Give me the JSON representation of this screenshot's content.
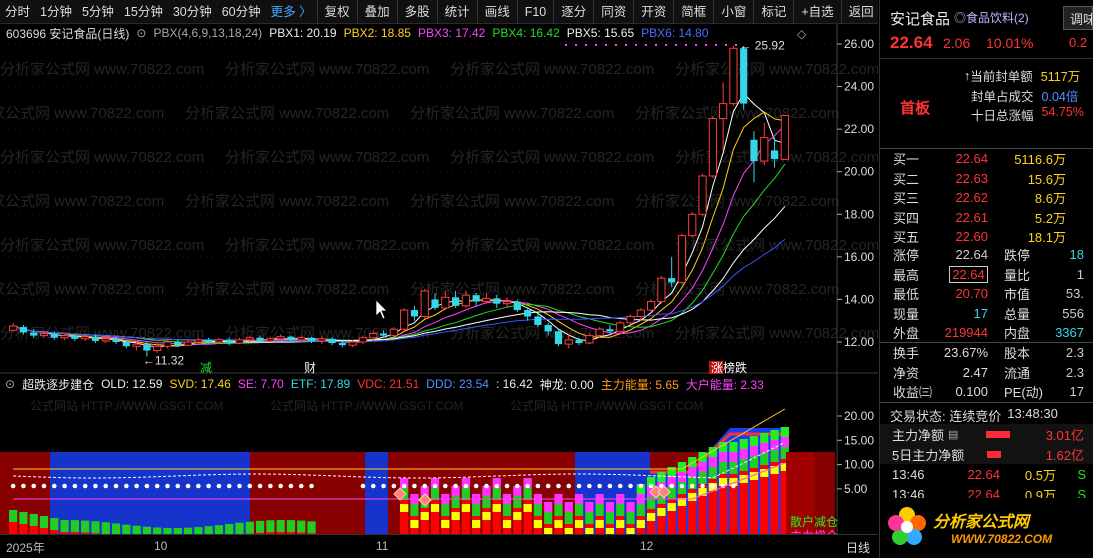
{
  "toolbar": {
    "periods": [
      "分时",
      "1分钟",
      "5分钟",
      "15分钟",
      "30分钟",
      "60分钟"
    ],
    "more": "更多 〉",
    "tools": [
      "复权",
      "叠加",
      "多股",
      "统计",
      "画线",
      "F10",
      "逐分",
      "同资",
      "开资",
      "简框",
      "小窗",
      "标记",
      "+自选",
      "返回"
    ]
  },
  "main_header": {
    "code_name": "603696 安记食品(日线)",
    "indicator": "PBX(4,6,9,13,18,24)",
    "pbx1": "PBX1: 20.19",
    "pbx2": "PBX2: 18.85",
    "pbx3": "PBX3: 17.42",
    "pbx4": "PBX4: 16.42",
    "pbx5": "PBX5: 15.65",
    "pbx6": "PBX6: 14.80"
  },
  "sub_header": {
    "name": "超跌逐步建仓",
    "old": "OLD: 12.59",
    "svd": "SVD: 17.46",
    "se": "SE: 7.70",
    "etf": "ETF: 17.89",
    "vdc": "VDC: 21.51",
    "ddd": "DDD: 23.54",
    "x": ": 16.42",
    "shenlong": "神龙: 0.00",
    "zhuli": "主力能量: 5.65",
    "dahu": "大户能量: 2.33"
  },
  "price_axis": [
    "26.00",
    "24.00",
    "22.00",
    "20.00",
    "18.00",
    "16.00",
    "14.00",
    "12.00"
  ],
  "sub_axis": [
    "20.00",
    "15.00",
    "10.00",
    "5.00"
  ],
  "annotations": {
    "high": "25.92",
    "low": "11.32",
    "mark1": "减",
    "mark2": "财",
    "mark3": "涨榜跌",
    "sub_label": "散户减仓\n主力增仓"
  },
  "time_axis": {
    "labels": [
      "2025年",
      "10",
      "11",
      "12"
    ],
    "daily": "日线"
  },
  "watermark": "分析家公式网 www.70822.com",
  "watermark2": "公式网站 HTTP://WWW.GSGT.COM",
  "right_panel": {
    "stock_name": "安记食品",
    "sector": "◎食品饮料(2)",
    "price": "22.64",
    "change": "2.06",
    "pct": "10.01%",
    "btn": "调味",
    "btn2": "0.2",
    "board": "首板",
    "seal_amount_label": "当前封单额",
    "seal_amount": "5117万",
    "seal_ratio_label": "封单占成交",
    "seal_ratio": "0.04倍",
    "ten_day_label": "十日总涨幅",
    "ten_day": "54.75%",
    "bids": [
      {
        "label": "买一",
        "price": "22.64",
        "vol": "5116.6万"
      },
      {
        "label": "买二",
        "price": "22.63",
        "vol": "15.6万"
      },
      {
        "label": "买三",
        "price": "22.62",
        "vol": "8.6万"
      },
      {
        "label": "买四",
        "price": "22.61",
        "vol": "5.2万"
      },
      {
        "label": "买五",
        "price": "22.60",
        "vol": "18.1万"
      }
    ],
    "stats1": [
      {
        "a": "涨停",
        "b": "22.64",
        "c": "跌停",
        "d": "18"
      },
      {
        "a": "最高",
        "b": "22.64",
        "c": "量比",
        "d": "1"
      },
      {
        "a": "最低",
        "b": "20.70",
        "c": "市值",
        "d": "53."
      },
      {
        "a": "现量",
        "b": "17",
        "c": "总量",
        "d": "556"
      },
      {
        "a": "外盘",
        "b": "219944",
        "c": "内盘",
        "d": "3367"
      }
    ],
    "stats2": [
      {
        "a": "换手",
        "b": "23.67%",
        "c": "股本",
        "d": "2.3"
      },
      {
        "a": "净资",
        "b": "2.47",
        "c": "流通",
        "d": "2.3"
      },
      {
        "a": "收益㈢",
        "b": "0.100",
        "c": "PE(动)",
        "d": "17"
      }
    ],
    "trade_status_label": "交易状态: 连续竞价",
    "trade_time": "13:48:30",
    "main_net_label": "主力净额",
    "main_net": "3.01亿",
    "five_day_label": "5日主力净额",
    "five_day": "1.62亿",
    "ticks": [
      {
        "t": "13:46",
        "p": "22.64",
        "v": "0.5万",
        "s": "S"
      },
      {
        "t": "13:46",
        "p": "22.64",
        "v": "0.9万",
        "s": "S"
      }
    ],
    "logo_text": "分析家公式网",
    "logo_url": "WWW.70822.COM"
  },
  "chart_data": {
    "type": "candlestick",
    "price_range": [
      11.0,
      26.8
    ],
    "candles": [
      {
        "o": 12.55,
        "c": 12.75,
        "h": 12.9,
        "l": 12.5
      },
      {
        "o": 12.7,
        "c": 12.45,
        "h": 12.8,
        "l": 12.35
      },
      {
        "o": 12.45,
        "c": 12.3,
        "h": 12.6,
        "l": 12.2
      },
      {
        "o": 12.3,
        "c": 12.4,
        "h": 12.55,
        "l": 12.2
      },
      {
        "o": 12.4,
        "c": 12.2,
        "h": 12.5,
        "l": 12.1
      },
      {
        "o": 12.2,
        "c": 12.3,
        "h": 12.4,
        "l": 12.1
      },
      {
        "o": 12.3,
        "c": 12.15,
        "h": 12.4,
        "l": 12.05
      },
      {
        "o": 12.15,
        "c": 12.25,
        "h": 12.35,
        "l": 12.05
      },
      {
        "o": 12.25,
        "c": 12.05,
        "h": 12.35,
        "l": 11.95
      },
      {
        "o": 12.05,
        "c": 12.15,
        "h": 12.3,
        "l": 11.95
      },
      {
        "o": 12.15,
        "c": 12.0,
        "h": 12.25,
        "l": 11.9
      },
      {
        "o": 12.0,
        "c": 11.8,
        "h": 12.1,
        "l": 11.7
      },
      {
        "o": 11.8,
        "c": 11.9,
        "h": 12.05,
        "l": 11.6
      },
      {
        "o": 11.9,
        "c": 11.6,
        "h": 12.0,
        "l": 11.32
      },
      {
        "o": 11.6,
        "c": 11.8,
        "h": 11.95,
        "l": 11.5
      },
      {
        "o": 11.8,
        "c": 12.0,
        "h": 12.1,
        "l": 11.7
      },
      {
        "o": 12.0,
        "c": 11.85,
        "h": 12.1,
        "l": 11.75
      },
      {
        "o": 11.85,
        "c": 12.0,
        "h": 12.1,
        "l": 11.8
      },
      {
        "o": 12.0,
        "c": 12.1,
        "h": 12.2,
        "l": 11.9
      },
      {
        "o": 12.1,
        "c": 12.0,
        "h": 12.2,
        "l": 11.9
      },
      {
        "o": 12.0,
        "c": 12.1,
        "h": 12.2,
        "l": 11.95
      },
      {
        "o": 12.1,
        "c": 11.95,
        "h": 12.2,
        "l": 11.85
      },
      {
        "o": 11.95,
        "c": 12.1,
        "h": 12.2,
        "l": 11.9
      },
      {
        "o": 12.1,
        "c": 12.2,
        "h": 12.3,
        "l": 12.0
      },
      {
        "o": 12.2,
        "c": 12.05,
        "h": 12.3,
        "l": 11.95
      },
      {
        "o": 12.05,
        "c": 12.15,
        "h": 12.25,
        "l": 12.0
      },
      {
        "o": 12.15,
        "c": 12.25,
        "h": 12.35,
        "l": 12.05
      },
      {
        "o": 12.25,
        "c": 12.1,
        "h": 12.3,
        "l": 12.0
      },
      {
        "o": 12.1,
        "c": 12.2,
        "h": 12.3,
        "l": 12.0
      },
      {
        "o": 12.2,
        "c": 12.05,
        "h": 12.25,
        "l": 11.95
      },
      {
        "o": 12.05,
        "c": 12.15,
        "h": 12.25,
        "l": 11.9
      },
      {
        "o": 12.15,
        "c": 11.95,
        "h": 12.2,
        "l": 11.85
      },
      {
        "o": 11.95,
        "c": 11.85,
        "h": 12.05,
        "l": 11.75
      },
      {
        "o": 11.85,
        "c": 12.0,
        "h": 12.1,
        "l": 11.75
      },
      {
        "o": 12.0,
        "c": 12.2,
        "h": 12.3,
        "l": 11.9
      },
      {
        "o": 12.2,
        "c": 12.4,
        "h": 12.5,
        "l": 12.1
      },
      {
        "o": 12.4,
        "c": 12.3,
        "h": 12.55,
        "l": 12.2
      },
      {
        "o": 12.3,
        "c": 12.6,
        "h": 12.7,
        "l": 12.25
      },
      {
        "o": 12.6,
        "c": 13.5,
        "h": 13.6,
        "l": 12.55
      },
      {
        "o": 13.5,
        "c": 13.2,
        "h": 13.7,
        "l": 13.0
      },
      {
        "o": 13.2,
        "c": 14.4,
        "h": 14.5,
        "l": 13.1
      },
      {
        "o": 14.0,
        "c": 13.6,
        "h": 14.3,
        "l": 13.5
      },
      {
        "o": 13.6,
        "c": 14.1,
        "h": 14.4,
        "l": 13.5
      },
      {
        "o": 14.1,
        "c": 13.7,
        "h": 14.4,
        "l": 13.6
      },
      {
        "o": 13.7,
        "c": 14.2,
        "h": 14.4,
        "l": 13.6
      },
      {
        "o": 14.2,
        "c": 13.9,
        "h": 14.3,
        "l": 13.7
      },
      {
        "o": 13.9,
        "c": 14.05,
        "h": 14.3,
        "l": 13.8
      },
      {
        "o": 14.05,
        "c": 13.8,
        "h": 14.2,
        "l": 13.6
      },
      {
        "o": 13.8,
        "c": 13.9,
        "h": 14.1,
        "l": 13.6
      },
      {
        "o": 13.9,
        "c": 13.5,
        "h": 14.0,
        "l": 13.4
      },
      {
        "o": 13.5,
        "c": 13.2,
        "h": 13.6,
        "l": 13.0
      },
      {
        "o": 13.2,
        "c": 12.8,
        "h": 13.3,
        "l": 12.7
      },
      {
        "o": 12.8,
        "c": 12.5,
        "h": 12.9,
        "l": 12.3
      },
      {
        "o": 12.5,
        "c": 11.9,
        "h": 12.6,
        "l": 11.8
      },
      {
        "o": 11.9,
        "c": 12.1,
        "h": 12.4,
        "l": 11.7
      },
      {
        "o": 12.1,
        "c": 11.95,
        "h": 12.2,
        "l": 11.85
      },
      {
        "o": 11.95,
        "c": 12.3,
        "h": 12.4,
        "l": 11.9
      },
      {
        "o": 12.3,
        "c": 12.6,
        "h": 12.7,
        "l": 12.2
      },
      {
        "o": 12.6,
        "c": 12.5,
        "h": 12.8,
        "l": 12.4
      },
      {
        "o": 12.5,
        "c": 12.9,
        "h": 13.0,
        "l": 12.4
      },
      {
        "o": 12.9,
        "c": 13.2,
        "h": 13.3,
        "l": 12.8
      },
      {
        "o": 13.2,
        "c": 13.5,
        "h": 13.6,
        "l": 13.0
      },
      {
        "o": 13.5,
        "c": 13.9,
        "h": 14.0,
        "l": 13.4
      },
      {
        "o": 13.9,
        "c": 15.0,
        "h": 15.1,
        "l": 13.8
      },
      {
        "o": 15.0,
        "c": 14.8,
        "h": 16.0,
        "l": 14.6
      },
      {
        "o": 14.8,
        "c": 17.0,
        "h": 17.1,
        "l": 14.7
      },
      {
        "o": 17.0,
        "c": 18.0,
        "h": 18.1,
        "l": 16.9
      },
      {
        "o": 18.0,
        "c": 19.8,
        "h": 19.9,
        "l": 17.9
      },
      {
        "o": 19.8,
        "c": 22.5,
        "h": 22.6,
        "l": 19.7
      },
      {
        "o": 22.5,
        "c": 23.2,
        "h": 24.2,
        "l": 21.0
      },
      {
        "o": 23.2,
        "c": 25.8,
        "h": 25.92,
        "l": 23.1
      },
      {
        "o": 25.8,
        "c": 23.2,
        "h": 25.9,
        "l": 22.9
      },
      {
        "o": 21.5,
        "c": 20.5,
        "h": 21.9,
        "l": 19.5
      },
      {
        "o": 20.5,
        "c": 21.6,
        "h": 22.3,
        "l": 20.3
      },
      {
        "o": 21.0,
        "c": 20.6,
        "h": 21.6,
        "l": 20.2
      },
      {
        "o": 20.58,
        "c": 22.64,
        "h": 22.64,
        "l": 20.7
      }
    ],
    "ma_lines": [
      {
        "name": "PBX1",
        "color": "#ffffff",
        "end": 20.19
      },
      {
        "name": "PBX2",
        "color": "#ffd21a",
        "end": 18.85
      },
      {
        "name": "PBX3",
        "color": "#ff44ff",
        "end": 17.42
      },
      {
        "name": "PBX4",
        "color": "#22dd22",
        "end": 16.42
      },
      {
        "name": "PBX5",
        "color": "#ffffff",
        "end": 15.65
      },
      {
        "name": "PBX6",
        "color": "#3355ff",
        "end": 14.8
      }
    ]
  }
}
